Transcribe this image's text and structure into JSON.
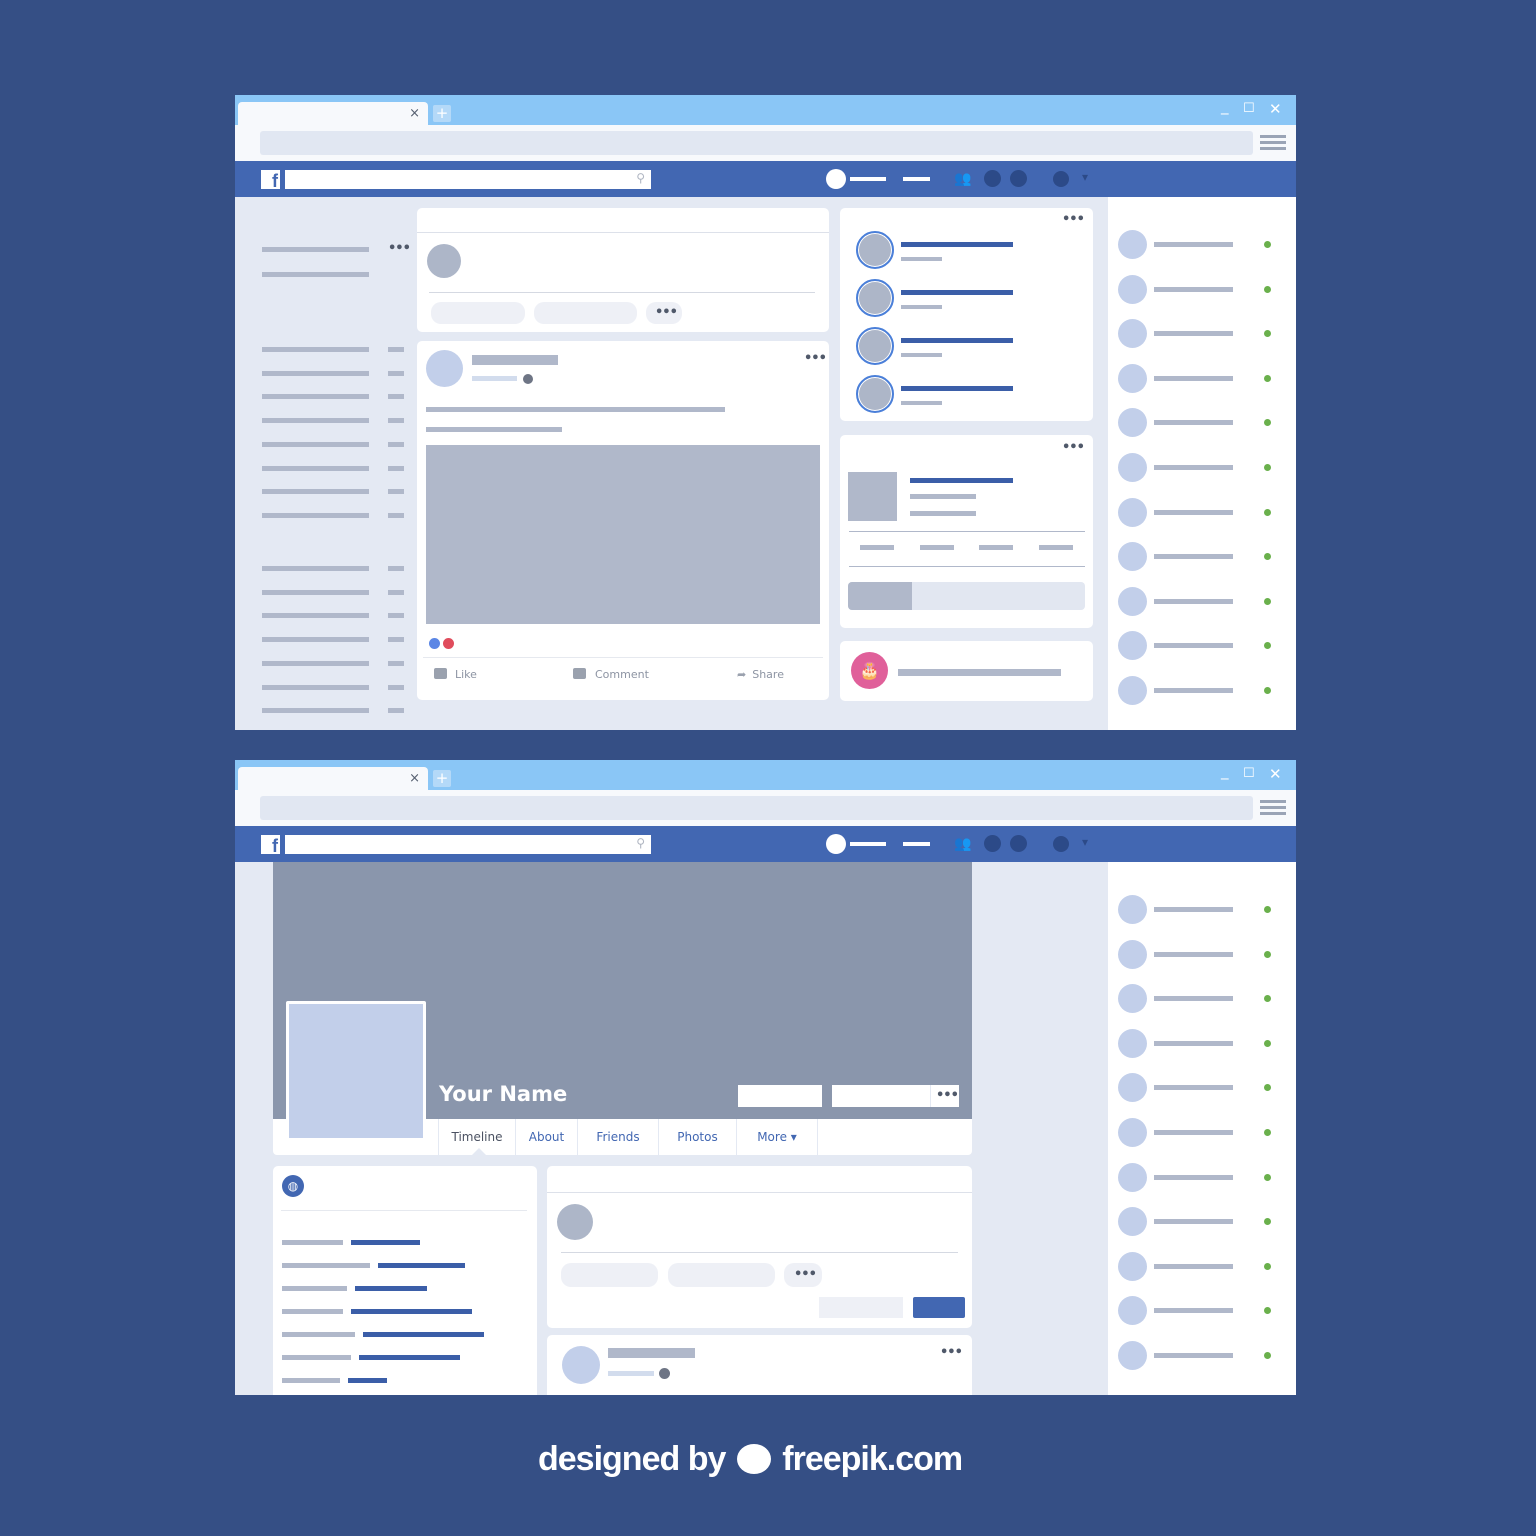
{
  "colors": {
    "page_bg": "#354f85",
    "fb_blue": "#4267b2",
    "titlebar": "#8ac6f6",
    "online": "#6ab04c",
    "birthday": "#e0609a"
  },
  "browser": {
    "tab_close": "×",
    "new_tab": "+",
    "minimize": "_",
    "maximize": "☐",
    "close": "✕"
  },
  "fb_header": {
    "logo": "f",
    "search_icon": "⚲",
    "dropdown": "▾"
  },
  "feed": {
    "more_icon": "•••",
    "post": {
      "actions": [
        {
          "icon": "thumbs-up",
          "label": "Like"
        },
        {
          "icon": "comment",
          "label": "Comment"
        },
        {
          "icon": "share",
          "label": "Share"
        }
      ]
    }
  },
  "profile": {
    "name": "Your Name",
    "tabs": [
      "Timeline",
      "About",
      "Friends",
      "Photos",
      "More ▾"
    ],
    "active_tab": "Timeline"
  },
  "watermark": {
    "text_left": "designed by",
    "text_right": "freepik.com"
  }
}
